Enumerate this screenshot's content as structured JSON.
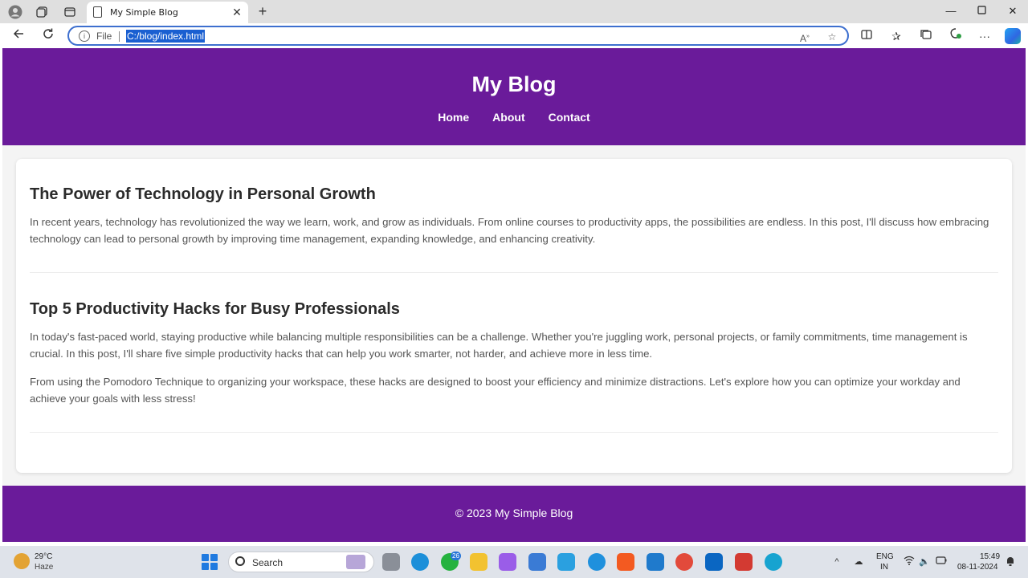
{
  "browser": {
    "tab_title": "My Simple Blog",
    "url_scheme_label": "File",
    "url": "C:/blog/index.html"
  },
  "site": {
    "title": "My Blog",
    "nav": [
      {
        "label": "Home"
      },
      {
        "label": "About"
      },
      {
        "label": "Contact"
      }
    ],
    "footer": "© 2023 My Simple Blog"
  },
  "posts": [
    {
      "title": "The Power of Technology in Personal Growth",
      "paragraphs": [
        "In recent years, technology has revolutionized the way we learn, work, and grow as individuals. From online courses to productivity apps, the possibilities are endless. In this post, I'll discuss how embracing technology can lead to personal growth by improving time management, expanding knowledge, and enhancing creativity."
      ]
    },
    {
      "title": "Top 5 Productivity Hacks for Busy Professionals",
      "paragraphs": [
        "In today's fast-paced world, staying productive while balancing multiple responsibilities can be a challenge. Whether you're juggling work, personal projects, or family commitments, time management is crucial. In this post, I'll share five simple productivity hacks that can help you work smarter, not harder, and achieve more in less time.",
        "From using the Pomodoro Technique to organizing your workspace, these hacks are designed to boost your efficiency and minimize distractions. Let's explore how you can optimize your workday and achieve your goals with less stress!"
      ]
    }
  ],
  "taskbar": {
    "weather_temp": "29°C",
    "weather_condition": "Haze",
    "search_label": "Search",
    "whatsapp_badge": "26",
    "lang_top": "ENG",
    "lang_bottom": "IN",
    "time": "15:49",
    "date": "08-11-2024"
  },
  "colors": {
    "brand_purple": "#6a1b9a",
    "url_highlight": "#1a5fd1"
  }
}
